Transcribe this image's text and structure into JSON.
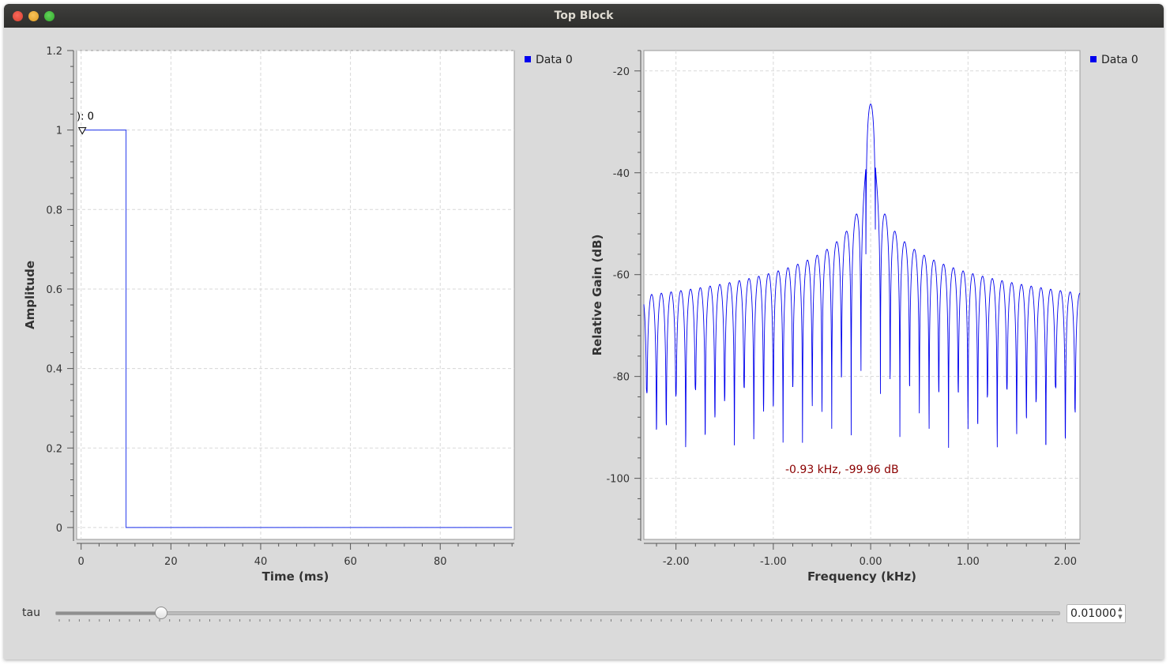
{
  "window": {
    "title": "Top Block"
  },
  "time_plot": {
    "legend": "Data 0",
    "marker_label": "): 0",
    "series_color": "#0000ee",
    "line_color": "#4455ee"
  },
  "freq_plot": {
    "legend": "Data 0",
    "cursor_readout": "-0.93 kHz, -99.96 dB",
    "series_color": "#0000ee",
    "readout_color": "#8b0000"
  },
  "controls": {
    "tau_label": "tau",
    "tau_value": "0.01000",
    "slider_fraction": 0.105
  },
  "chart_data": [
    {
      "type": "line",
      "xlabel": "Time (ms)",
      "ylabel": "Amplitude",
      "xlim": [
        -1,
        96.5
      ],
      "ylim": [
        -0.03,
        1.2
      ],
      "xticks": [
        0,
        20,
        40,
        60,
        80
      ],
      "xtick_labels": [
        "0",
        "20",
        "40",
        "60",
        "80"
      ],
      "yticks": [
        0,
        0.2,
        0.4,
        0.6,
        0.8,
        1,
        1.2
      ],
      "ytick_labels": [
        "0",
        "0.2",
        "0.4",
        "0.6",
        "0.8",
        "1",
        "1.2"
      ],
      "grid": true,
      "legend_position": "outside-top-right",
      "series": [
        {
          "name": "Data 0",
          "x": [
            0,
            10,
            10,
            96
          ],
          "y": [
            1,
            1,
            0,
            0
          ]
        }
      ]
    },
    {
      "type": "line",
      "xlabel": "Frequency (kHz)",
      "ylabel": "Relative Gain (dB)",
      "xlim": [
        -2.33,
        2.15
      ],
      "ylim": [
        -112,
        -16
      ],
      "xticks": [
        -2,
        -1,
        0,
        1,
        2
      ],
      "xtick_labels": [
        "-2.00",
        "-1.00",
        "0.00",
        "1.00",
        "2.00"
      ],
      "yticks": [
        -20,
        -40,
        -60,
        -80,
        -100
      ],
      "ytick_labels": [
        "-20",
        "-40",
        "-60",
        "-80",
        "-100"
      ],
      "grid": true,
      "legend_position": "outside-top-right",
      "series": [
        {
          "name": "Data 0",
          "x_range": [
            -2.33,
            2.15
          ],
          "lobe_spacing": 0.1,
          "main_lobe_peak_db": -26.5,
          "lobe_peak_at_edges_db": -64,
          "null_depth_db": -86
        }
      ]
    }
  ]
}
